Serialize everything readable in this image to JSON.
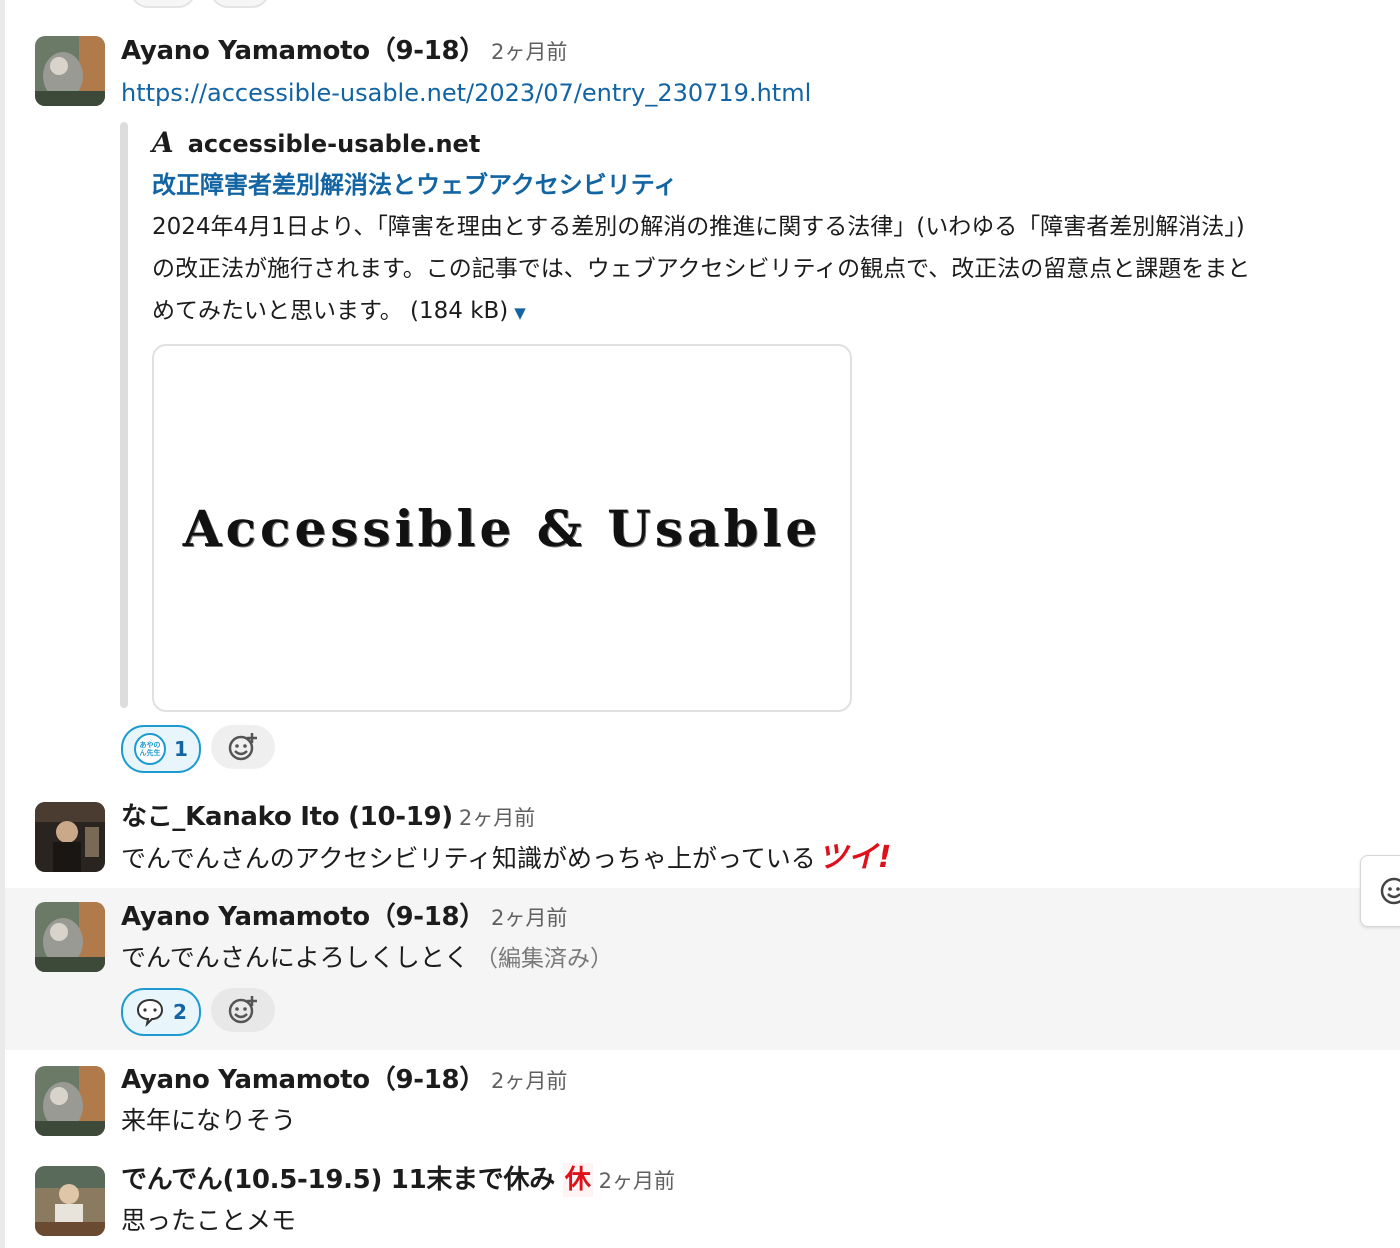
{
  "messages": [
    {
      "author": "Ayano Yamamoto（9-18）",
      "time": "2ヶ月前",
      "link": "https://accessible-usable.net/2023/07/entry_230719.html",
      "unfurl": {
        "site_logo": "A",
        "site": "accessible-usable.net",
        "title": "改正障害者差別解消法とウェブアクセシビリティ",
        "description": "2024年4月1日より、「障害を理由とする差別の解消の推進に関する法律」(いわゆる「障害者差別解消法」) の改正法が施行されます。この記事では、ウェブアクセシビリティの観点で、改正法の留意点と課題をまとめてみたいと思います。",
        "size": "(184 kB)",
        "preview_text": "Accessible & Usable"
      },
      "reaction": {
        "emoji_text": "あやのん先生",
        "count": "1"
      }
    },
    {
      "author": "なこ_Kanako Ito (10-19)",
      "time": "2ヶ月前",
      "text": "でんでんさんのアクセシビリティ知識がめっちゃ上がっている",
      "emoji_text": "ツイ!"
    },
    {
      "author": "Ayano Yamamoto（9-18）",
      "time": "2ヶ月前",
      "text": "でんでんさんによろしくしとく",
      "edited": "（編集済み）",
      "reaction": {
        "emoji": "thinking-bubble",
        "count": "2"
      }
    },
    {
      "author": "Ayano Yamamoto（9-18）",
      "time": "2ヶ月前",
      "text": "来年になりそう"
    },
    {
      "author": "でんでん(10.5-19.5) 11末まで休み",
      "status_emoji_text": "休",
      "time": "2ヶ月前",
      "text": "思ったことメモ"
    }
  ],
  "colors": {
    "link": "#1264a3",
    "highlight": "#f5f5f5",
    "reaction_border": "#1d9bd1"
  }
}
